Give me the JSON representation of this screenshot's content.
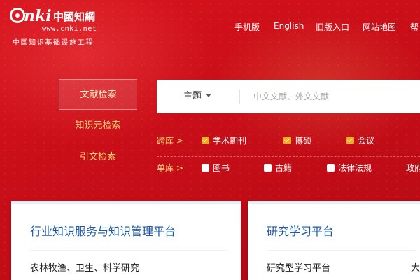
{
  "header": {
    "logo_alt": "CNKI 中国知网",
    "logo_url": "www.cnki.net",
    "logo_subtitle": "中国知识基础设施工程",
    "nav": [
      "手机版",
      "English",
      "旧版入口",
      "网站地图",
      "帮"
    ]
  },
  "side_tabs": [
    {
      "label": "文献检索",
      "active": true
    },
    {
      "label": "知识元检索",
      "active": false
    },
    {
      "label": "引文检索",
      "active": false
    }
  ],
  "search": {
    "field": "主题",
    "placeholder": "中文文献、外文文献"
  },
  "databases": {
    "cross_label": "跨库 >",
    "cross_options": [
      {
        "label": "学术期刊",
        "checked": true
      },
      {
        "label": "博硕",
        "checked": true
      },
      {
        "label": "会议",
        "checked": true
      }
    ],
    "single_label": "单库 >",
    "single_options": [
      {
        "label": "图书",
        "checked": false
      },
      {
        "label": "古籍",
        "checked": false
      },
      {
        "label": "法律法规",
        "checked": false
      },
      {
        "label": "政府",
        "checked": false
      }
    ]
  },
  "cards": [
    {
      "title": "行业知识服务与知识管理平台",
      "line1": "农林牧渔、卫生、科学研究"
    },
    {
      "title": "研究学习平台",
      "line1": "研究型学习平台",
      "line2": "大"
    }
  ],
  "colors": {
    "brand_red": "#c8101a",
    "accent_gold": "#ffd87a",
    "checkbox_orange": "#f5a623",
    "card_title_blue": "#1a5aa8"
  }
}
